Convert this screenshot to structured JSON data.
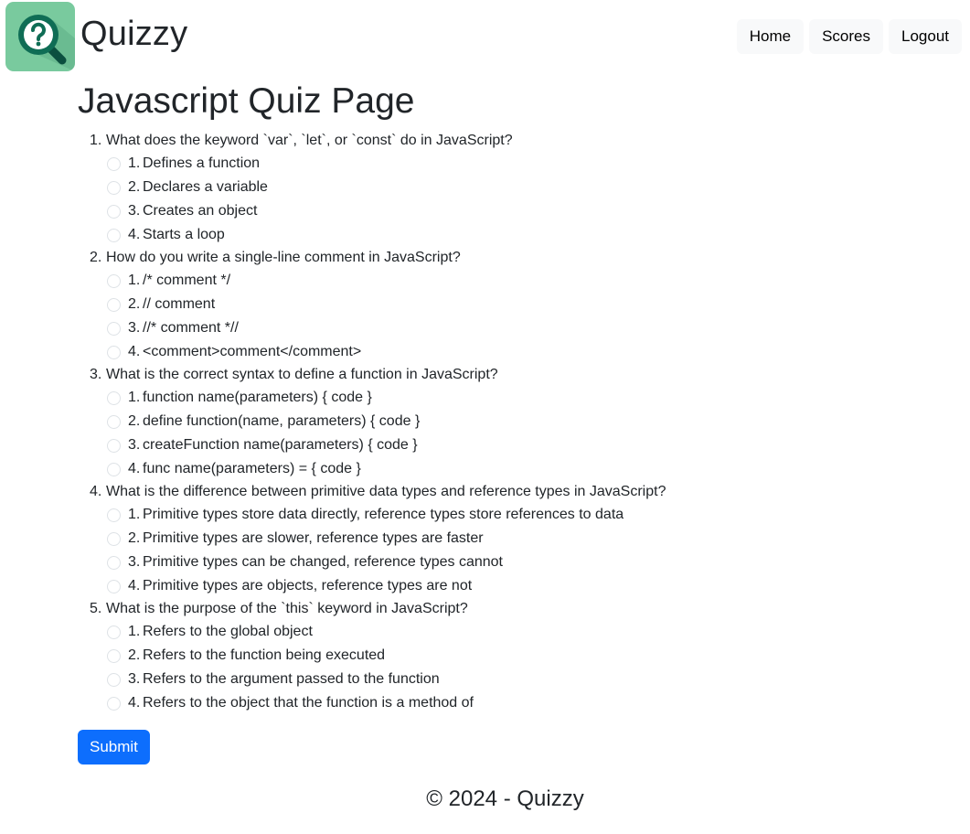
{
  "brand": {
    "name": "Quizzy",
    "logo_icon": "search-question-icon",
    "logo_color": "#79ca9e"
  },
  "nav": {
    "home_label": "Home",
    "scores_label": "Scores",
    "logout_label": "Logout"
  },
  "page_title": "Javascript Quiz Page",
  "questions": [
    {
      "number": "1.",
      "text": "What does the keyword `var`, `let`, or `const` do in JavaScript?",
      "options": [
        {
          "number": "1.",
          "text": "Defines a function"
        },
        {
          "number": "2.",
          "text": "Declares a variable"
        },
        {
          "number": "3.",
          "text": "Creates an object"
        },
        {
          "number": "4.",
          "text": "Starts a loop"
        }
      ]
    },
    {
      "number": "2.",
      "text": "How do you write a single-line comment in JavaScript?",
      "options": [
        {
          "number": "1.",
          "text": "/* comment */"
        },
        {
          "number": "2.",
          "text": "// comment"
        },
        {
          "number": "3.",
          "text": "//* comment *//"
        },
        {
          "number": "4.",
          "text": "<comment>comment</comment>"
        }
      ]
    },
    {
      "number": "3.",
      "text": "What is the correct syntax to define a function in JavaScript?",
      "options": [
        {
          "number": "1.",
          "text": "function name(parameters) { code }"
        },
        {
          "number": "2.",
          "text": "define function(name, parameters) { code }"
        },
        {
          "number": "3.",
          "text": "createFunction name(parameters) { code }"
        },
        {
          "number": "4.",
          "text": "func name(parameters) = { code }"
        }
      ]
    },
    {
      "number": "4.",
      "text": "What is the difference between primitive data types and reference types in JavaScript?",
      "options": [
        {
          "number": "1.",
          "text": "Primitive types store data directly, reference types store references to data"
        },
        {
          "number": "2.",
          "text": "Primitive types are slower, reference types are faster"
        },
        {
          "number": "3.",
          "text": "Primitive types can be changed, reference types cannot"
        },
        {
          "number": "4.",
          "text": "Primitive types are objects, reference types are not"
        }
      ]
    },
    {
      "number": "5.",
      "text": "What is the purpose of the `this` keyword in JavaScript?",
      "options": [
        {
          "number": "1.",
          "text": "Refers to the global object"
        },
        {
          "number": "2.",
          "text": "Refers to the function being executed"
        },
        {
          "number": "3.",
          "text": "Refers to the argument passed to the function"
        },
        {
          "number": "4.",
          "text": "Refers to the object that the function is a method of"
        }
      ]
    }
  ],
  "submit_label": "Submit",
  "submit_color": "#0d6efd",
  "footer_text": "© 2024 - Quizzy"
}
